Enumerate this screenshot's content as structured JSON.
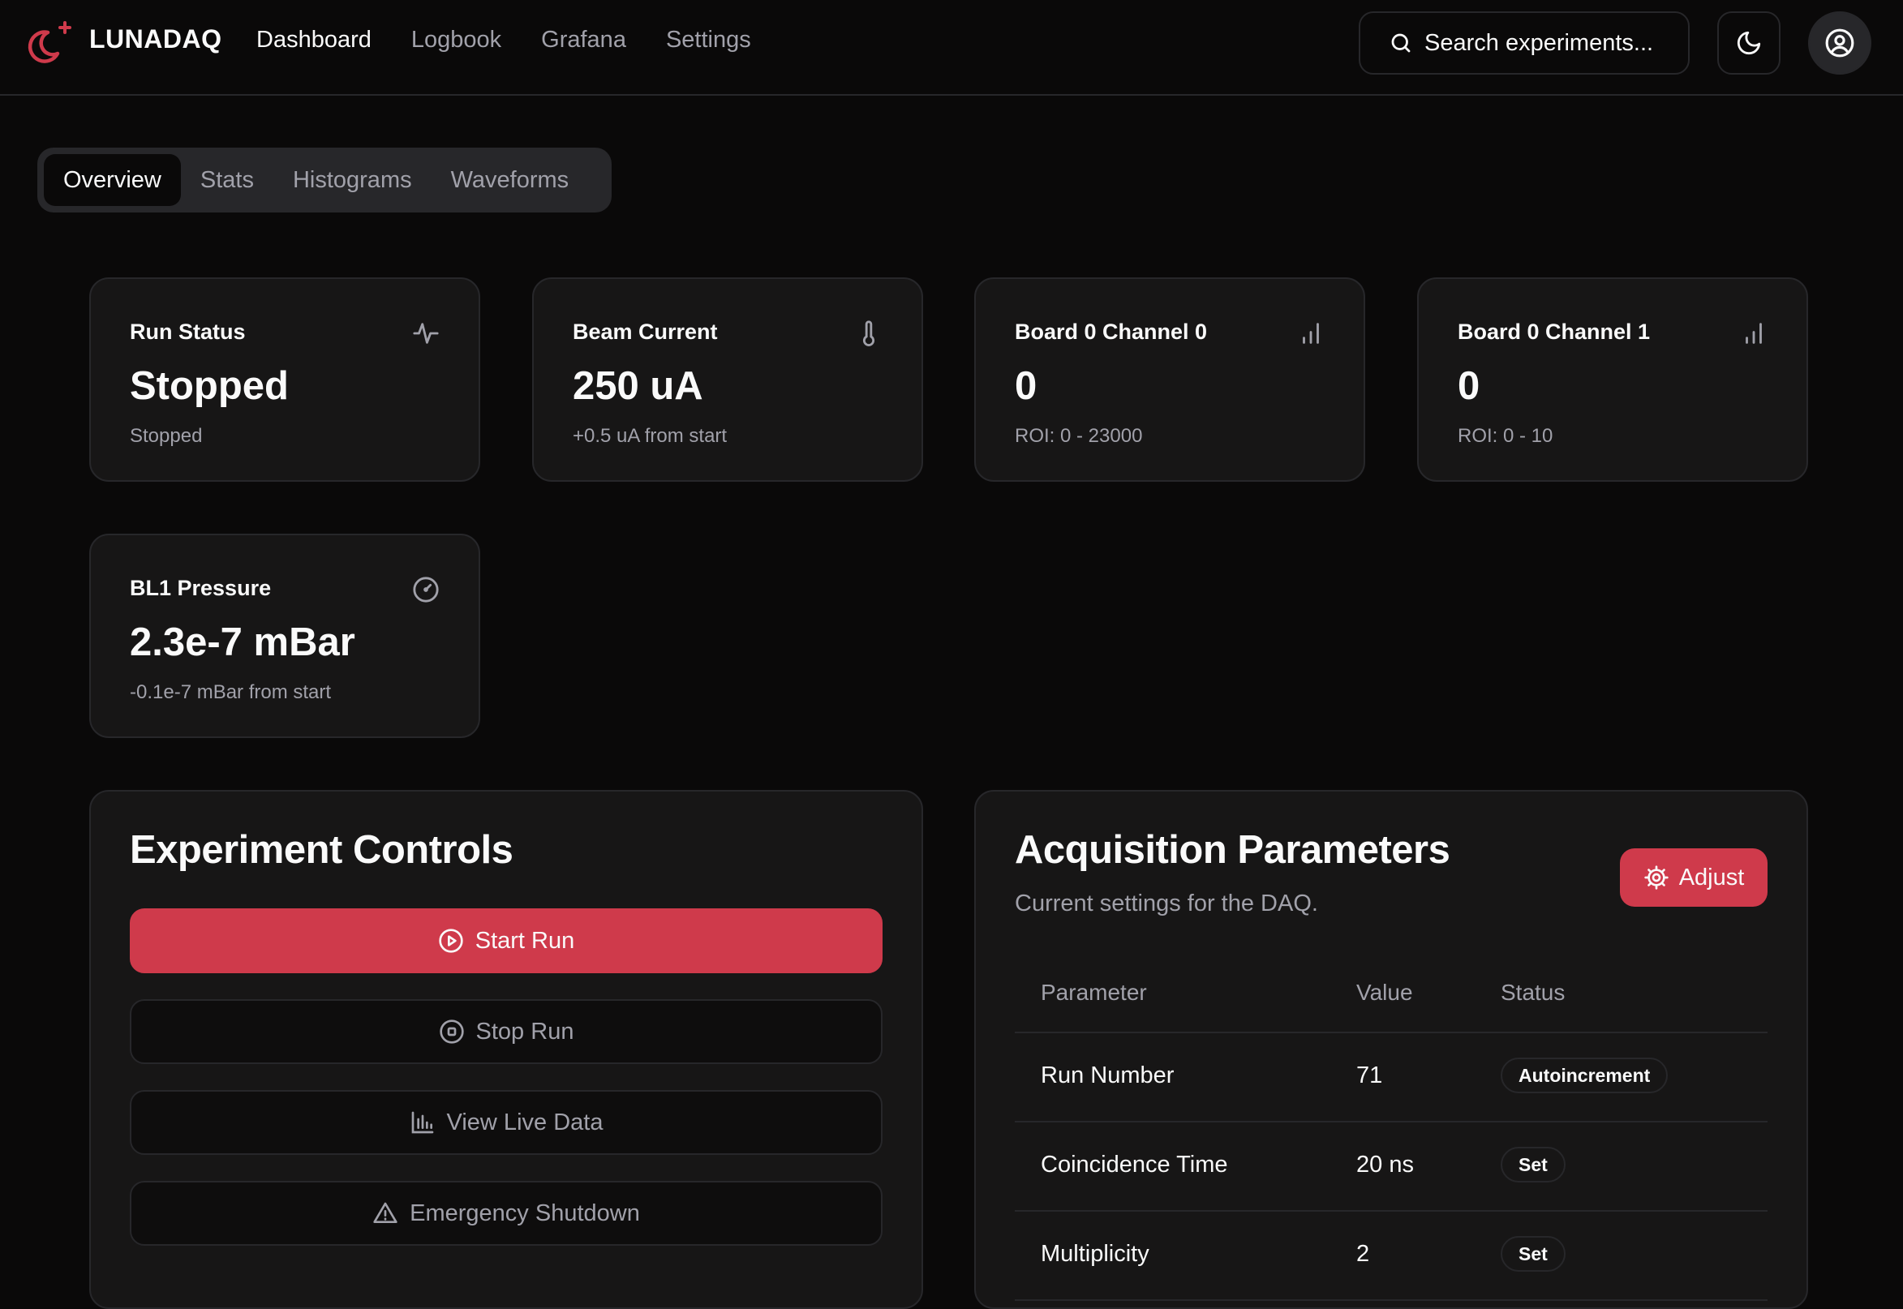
{
  "brand": {
    "name": "LUNADAQ",
    "logo_icon": "moon-plus-icon",
    "accent": "#cf3a4b"
  },
  "nav": [
    {
      "label": "Dashboard",
      "active": true
    },
    {
      "label": "Logbook"
    },
    {
      "label": "Grafana"
    },
    {
      "label": "Settings"
    }
  ],
  "search": {
    "placeholder": "Search experiments...",
    "icon": "search-icon"
  },
  "header_buttons": {
    "theme_icon": "moon-icon",
    "user_icon": "user-circle-icon"
  },
  "tabs": [
    {
      "label": "Overview",
      "active": true
    },
    {
      "label": "Stats"
    },
    {
      "label": "Histograms"
    },
    {
      "label": "Waveforms"
    }
  ],
  "stats": [
    {
      "label": "Run Status",
      "value": "Stopped",
      "sub": "Stopped",
      "icon": "activity-icon"
    },
    {
      "label": "Beam Current",
      "value": "250 uA",
      "sub": "+0.5 uA from start",
      "icon": "thermometer-icon"
    },
    {
      "label": "Board 0 Channel 0",
      "value": "0",
      "sub": "ROI: 0 - 23000",
      "icon": "bar-chart-icon"
    },
    {
      "label": "Board 0 Channel 1",
      "value": "0",
      "sub": "ROI: 0 - 10",
      "icon": "bar-chart-icon"
    },
    {
      "label": "BL1 Pressure",
      "value": "2.3e-7 mBar",
      "sub": "-0.1e-7 mBar from start",
      "icon": "gauge-icon"
    }
  ],
  "controls": {
    "title": "Experiment Controls",
    "buttons": [
      {
        "label": "Start Run",
        "icon": "play-circle-icon"
      },
      {
        "label": "Stop Run",
        "icon": "stop-circle-icon"
      },
      {
        "label": "View Live Data",
        "icon": "chart-icon"
      },
      {
        "label": "Emergency Shutdown",
        "icon": "warning-icon"
      }
    ]
  },
  "acquisition": {
    "title": "Acquisition Parameters",
    "subtitle": "Current settings for the DAQ.",
    "adjust_label": "Adjust",
    "columns": [
      "Parameter",
      "Value",
      "Status"
    ],
    "rows": [
      {
        "parameter": "Run Number",
        "value": "71",
        "status": "Autoincrement"
      },
      {
        "parameter": "Coincidence Time",
        "value": "20 ns",
        "status": "Set"
      },
      {
        "parameter": "Multiplicity",
        "value": "2",
        "status": "Set"
      }
    ]
  }
}
